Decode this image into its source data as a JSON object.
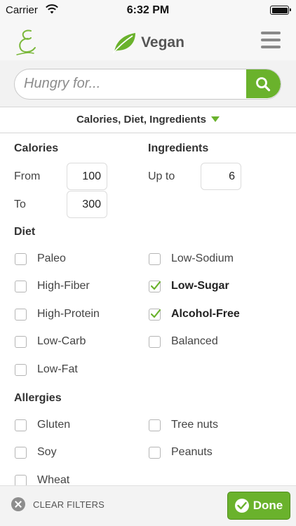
{
  "status_bar": {
    "carrier": "Carrier",
    "time": "6:32 PM"
  },
  "nav": {
    "title": "Vegan",
    "logo_icon": "script-e-logo",
    "brand_icon": "leaf-icon",
    "menu_icon": "hamburger-menu-icon"
  },
  "search": {
    "placeholder": "Hungry for...",
    "value": "",
    "icon": "search-icon"
  },
  "filter_header": {
    "label": "Calories, Diet, Ingredients",
    "expanded_icon": "caret-down-icon"
  },
  "calories": {
    "title": "Calories",
    "from_label": "From",
    "from_value": "100",
    "to_label": "To",
    "to_value": "300"
  },
  "ingredients": {
    "title": "Ingredients",
    "upto_label": "Up to",
    "upto_value": "6"
  },
  "diet": {
    "title": "Diet",
    "items": [
      {
        "label": "Paleo",
        "checked": false
      },
      {
        "label": "High-Fiber",
        "checked": false
      },
      {
        "label": "High-Protein",
        "checked": false
      },
      {
        "label": "Low-Carb",
        "checked": false
      },
      {
        "label": "Low-Fat",
        "checked": false
      },
      {
        "label": "Low-Sodium",
        "checked": false
      },
      {
        "label": "Low-Sugar",
        "checked": true
      },
      {
        "label": "Alcohol-Free",
        "checked": true
      },
      {
        "label": "Balanced",
        "checked": false
      }
    ]
  },
  "allergies": {
    "title": "Allergies",
    "items": [
      {
        "label": "Gluten",
        "checked": false
      },
      {
        "label": "Soy",
        "checked": false
      },
      {
        "label": "Wheat",
        "checked": false
      },
      {
        "label": "Tree nuts",
        "checked": false
      },
      {
        "label": "Peanuts",
        "checked": false
      }
    ]
  },
  "bottom_bar": {
    "clear_label": "CLEAR FILTERS",
    "done_label": "Done"
  },
  "colors": {
    "accent": "#6ab22c",
    "text": "#444444"
  }
}
